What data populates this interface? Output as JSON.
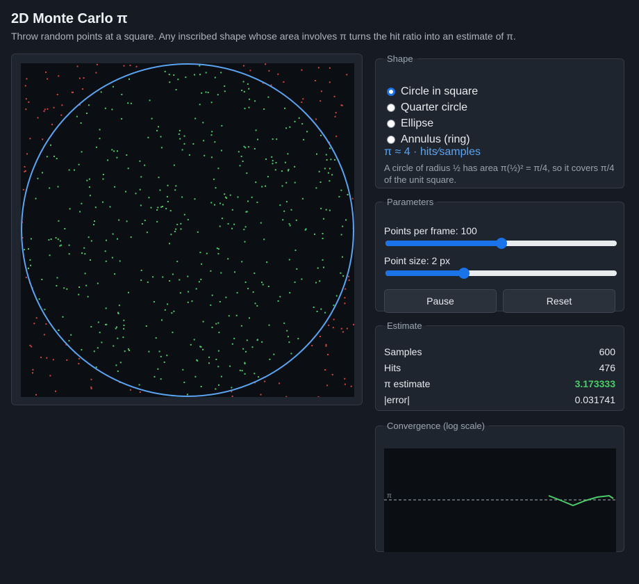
{
  "page": {
    "title": "2D Monte Carlo π",
    "subtitle": "Throw random points at a square. Any inscribed shape whose area involves π turns the hit ratio into an estimate of π."
  },
  "colors": {
    "background": "#161b23",
    "panel": "#1f252e",
    "accent_blue": "#5aa3f0",
    "hit_green": "#4ccb6a",
    "miss_red": "#d6453e",
    "slider_blue": "#1a73e8"
  },
  "shape": {
    "legend": "Shape",
    "options": [
      {
        "label": "Circle in square",
        "checked": true
      },
      {
        "label": "Quarter circle",
        "checked": false
      },
      {
        "label": "Ellipse",
        "checked": false
      },
      {
        "label": "Annulus (ring)",
        "checked": false
      }
    ],
    "formula": "π ≈ 4 · hits∕samples",
    "explanation": "A circle of radius ½ has area π(½)² = π/4, so it covers π/4 of the unit square."
  },
  "parameters": {
    "legend": "Parameters",
    "points_per_frame_label": "Points per frame: 100",
    "points_per_frame_level": 0.5,
    "point_size_label": "Point size: 2 px",
    "point_size_level": 0.34,
    "pause_label": "Pause",
    "reset_label": "Reset"
  },
  "estimate": {
    "legend": "Estimate",
    "rows": [
      {
        "label": "Samples",
        "value": "600"
      },
      {
        "label": "Hits",
        "value": "476"
      },
      {
        "label": "π estimate",
        "value": "3.173333"
      },
      {
        "label": "|error|",
        "value": "0.031741"
      }
    ]
  },
  "convergence": {
    "legend": "Convergence (log scale)",
    "pi_marker": "π"
  }
}
